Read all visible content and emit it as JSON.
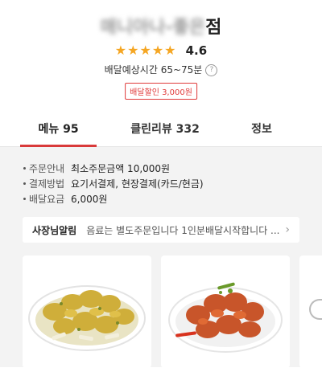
{
  "store": {
    "name_blurred": "매니아나-좋은",
    "name_suffix": "점",
    "stars": "★★★★★",
    "rating": "4.6",
    "delivery_time": "배달예상시간 65~75분",
    "discount_badge": "배달할인 3,000원"
  },
  "tabs": [
    {
      "label": "메뉴 95",
      "active": true
    },
    {
      "label": "클린리뷰 332",
      "active": false
    },
    {
      "label": "정보",
      "active": false
    }
  ],
  "info": [
    {
      "label": "주문안내",
      "value": "최소주문금액 10,000원"
    },
    {
      "label": "결제방법",
      "value": "요기서결제, 현장결제(카드/현금)"
    },
    {
      "label": "배달요금",
      "value": "6,000원"
    }
  ],
  "notice": {
    "title": "사장님알림",
    "text": "음료는 별도주문입니다 1인분배달시작합니다 ..."
  },
  "colors": {
    "accent": "#d93a3a",
    "star": "#f5a623",
    "background_gray": "#f3f3f3"
  },
  "icons": {
    "help": "question-circle-icon",
    "chevron": "chevron-right-icon",
    "carousel": "carousel-prev-icon"
  }
}
